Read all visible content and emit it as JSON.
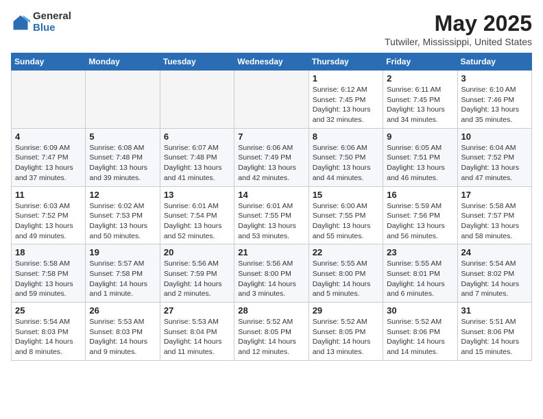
{
  "header": {
    "logo_general": "General",
    "logo_blue": "Blue",
    "month_title": "May 2025",
    "location": "Tutwiler, Mississippi, United States"
  },
  "weekdays": [
    "Sunday",
    "Monday",
    "Tuesday",
    "Wednesday",
    "Thursday",
    "Friday",
    "Saturday"
  ],
  "weeks": [
    [
      {
        "day": "",
        "info": "",
        "empty": true
      },
      {
        "day": "",
        "info": "",
        "empty": true
      },
      {
        "day": "",
        "info": "",
        "empty": true
      },
      {
        "day": "",
        "info": "",
        "empty": true
      },
      {
        "day": "1",
        "info": "Sunrise: 6:12 AM\nSunset: 7:45 PM\nDaylight: 13 hours\nand 32 minutes."
      },
      {
        "day": "2",
        "info": "Sunrise: 6:11 AM\nSunset: 7:45 PM\nDaylight: 13 hours\nand 34 minutes."
      },
      {
        "day": "3",
        "info": "Sunrise: 6:10 AM\nSunset: 7:46 PM\nDaylight: 13 hours\nand 35 minutes."
      }
    ],
    [
      {
        "day": "4",
        "info": "Sunrise: 6:09 AM\nSunset: 7:47 PM\nDaylight: 13 hours\nand 37 minutes."
      },
      {
        "day": "5",
        "info": "Sunrise: 6:08 AM\nSunset: 7:48 PM\nDaylight: 13 hours\nand 39 minutes."
      },
      {
        "day": "6",
        "info": "Sunrise: 6:07 AM\nSunset: 7:48 PM\nDaylight: 13 hours\nand 41 minutes."
      },
      {
        "day": "7",
        "info": "Sunrise: 6:06 AM\nSunset: 7:49 PM\nDaylight: 13 hours\nand 42 minutes."
      },
      {
        "day": "8",
        "info": "Sunrise: 6:06 AM\nSunset: 7:50 PM\nDaylight: 13 hours\nand 44 minutes."
      },
      {
        "day": "9",
        "info": "Sunrise: 6:05 AM\nSunset: 7:51 PM\nDaylight: 13 hours\nand 46 minutes."
      },
      {
        "day": "10",
        "info": "Sunrise: 6:04 AM\nSunset: 7:52 PM\nDaylight: 13 hours\nand 47 minutes."
      }
    ],
    [
      {
        "day": "11",
        "info": "Sunrise: 6:03 AM\nSunset: 7:52 PM\nDaylight: 13 hours\nand 49 minutes."
      },
      {
        "day": "12",
        "info": "Sunrise: 6:02 AM\nSunset: 7:53 PM\nDaylight: 13 hours\nand 50 minutes."
      },
      {
        "day": "13",
        "info": "Sunrise: 6:01 AM\nSunset: 7:54 PM\nDaylight: 13 hours\nand 52 minutes."
      },
      {
        "day": "14",
        "info": "Sunrise: 6:01 AM\nSunset: 7:55 PM\nDaylight: 13 hours\nand 53 minutes."
      },
      {
        "day": "15",
        "info": "Sunrise: 6:00 AM\nSunset: 7:55 PM\nDaylight: 13 hours\nand 55 minutes."
      },
      {
        "day": "16",
        "info": "Sunrise: 5:59 AM\nSunset: 7:56 PM\nDaylight: 13 hours\nand 56 minutes."
      },
      {
        "day": "17",
        "info": "Sunrise: 5:58 AM\nSunset: 7:57 PM\nDaylight: 13 hours\nand 58 minutes."
      }
    ],
    [
      {
        "day": "18",
        "info": "Sunrise: 5:58 AM\nSunset: 7:58 PM\nDaylight: 13 hours\nand 59 minutes."
      },
      {
        "day": "19",
        "info": "Sunrise: 5:57 AM\nSunset: 7:58 PM\nDaylight: 14 hours\nand 1 minute."
      },
      {
        "day": "20",
        "info": "Sunrise: 5:56 AM\nSunset: 7:59 PM\nDaylight: 14 hours\nand 2 minutes."
      },
      {
        "day": "21",
        "info": "Sunrise: 5:56 AM\nSunset: 8:00 PM\nDaylight: 14 hours\nand 3 minutes."
      },
      {
        "day": "22",
        "info": "Sunrise: 5:55 AM\nSunset: 8:00 PM\nDaylight: 14 hours\nand 5 minutes."
      },
      {
        "day": "23",
        "info": "Sunrise: 5:55 AM\nSunset: 8:01 PM\nDaylight: 14 hours\nand 6 minutes."
      },
      {
        "day": "24",
        "info": "Sunrise: 5:54 AM\nSunset: 8:02 PM\nDaylight: 14 hours\nand 7 minutes."
      }
    ],
    [
      {
        "day": "25",
        "info": "Sunrise: 5:54 AM\nSunset: 8:03 PM\nDaylight: 14 hours\nand 8 minutes."
      },
      {
        "day": "26",
        "info": "Sunrise: 5:53 AM\nSunset: 8:03 PM\nDaylight: 14 hours\nand 9 minutes."
      },
      {
        "day": "27",
        "info": "Sunrise: 5:53 AM\nSunset: 8:04 PM\nDaylight: 14 hours\nand 11 minutes."
      },
      {
        "day": "28",
        "info": "Sunrise: 5:52 AM\nSunset: 8:05 PM\nDaylight: 14 hours\nand 12 minutes."
      },
      {
        "day": "29",
        "info": "Sunrise: 5:52 AM\nSunset: 8:05 PM\nDaylight: 14 hours\nand 13 minutes."
      },
      {
        "day": "30",
        "info": "Sunrise: 5:52 AM\nSunset: 8:06 PM\nDaylight: 14 hours\nand 14 minutes."
      },
      {
        "day": "31",
        "info": "Sunrise: 5:51 AM\nSunset: 8:06 PM\nDaylight: 14 hours\nand 15 minutes."
      }
    ]
  ]
}
